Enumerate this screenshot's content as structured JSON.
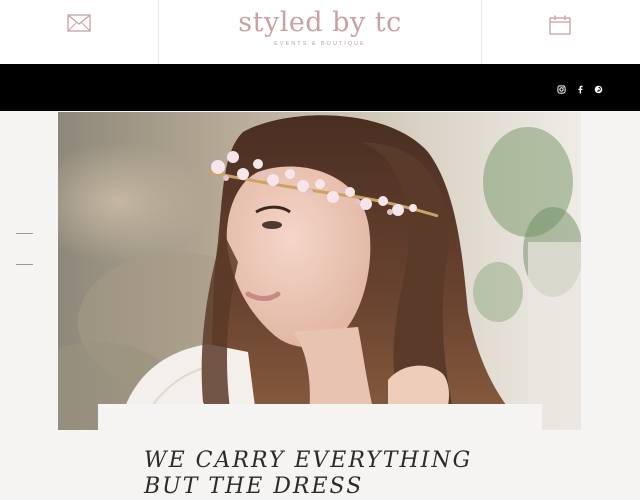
{
  "header": {
    "logo_main": "styled by tc",
    "logo_sub": "EVENTS & BOUTIQUE",
    "mail_icon": "envelope-icon",
    "calendar_icon": "calendar-icon"
  },
  "social": [
    {
      "name": "instagram-icon"
    },
    {
      "name": "facebook-icon"
    },
    {
      "name": "pinterest-icon"
    }
  ],
  "hero": {
    "image": "bride-with-floral-headpiece-photo"
  },
  "headline": "WE CARRY EVERYTHING BUT THE DRESS",
  "colors": {
    "accent": "#c7a2a0",
    "navbar": "#000000",
    "background": "#f6f4f3",
    "headline": "#2b2b2b"
  }
}
